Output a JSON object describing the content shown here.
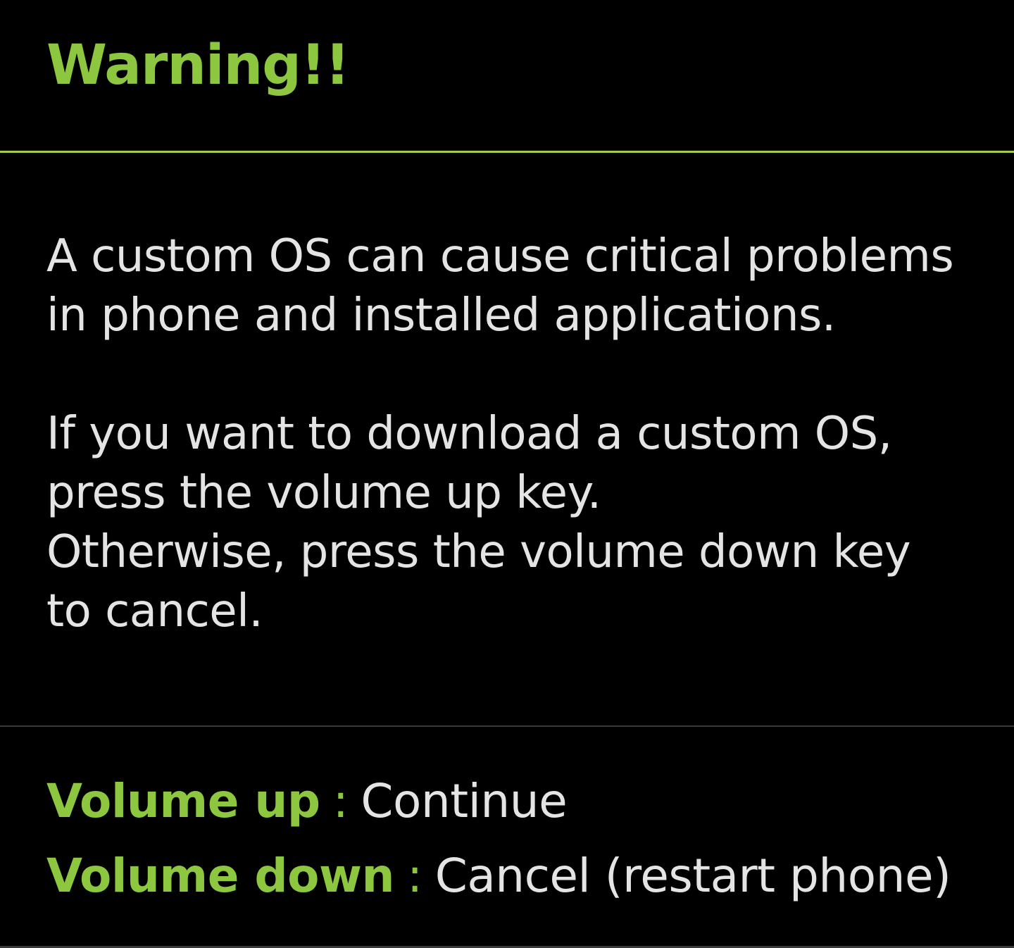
{
  "title": "Warning!!",
  "message": {
    "paragraphs": [
      [
        "A custom OS can cause critical problems",
        "in phone and installed applications."
      ],
      [
        "If you want to download a custom OS,",
        "press the volume up key.",
        "Otherwise, press the volume down key",
        "to cancel."
      ]
    ]
  },
  "options": [
    {
      "key": "Volume up",
      "separator": ":",
      "action": "Continue"
    },
    {
      "key": "Volume down",
      "separator": ":",
      "action": "Cancel (restart phone)"
    }
  ],
  "colors": {
    "background": "#000000",
    "accent": "#8dc63f",
    "text": "#e4e4e4"
  }
}
